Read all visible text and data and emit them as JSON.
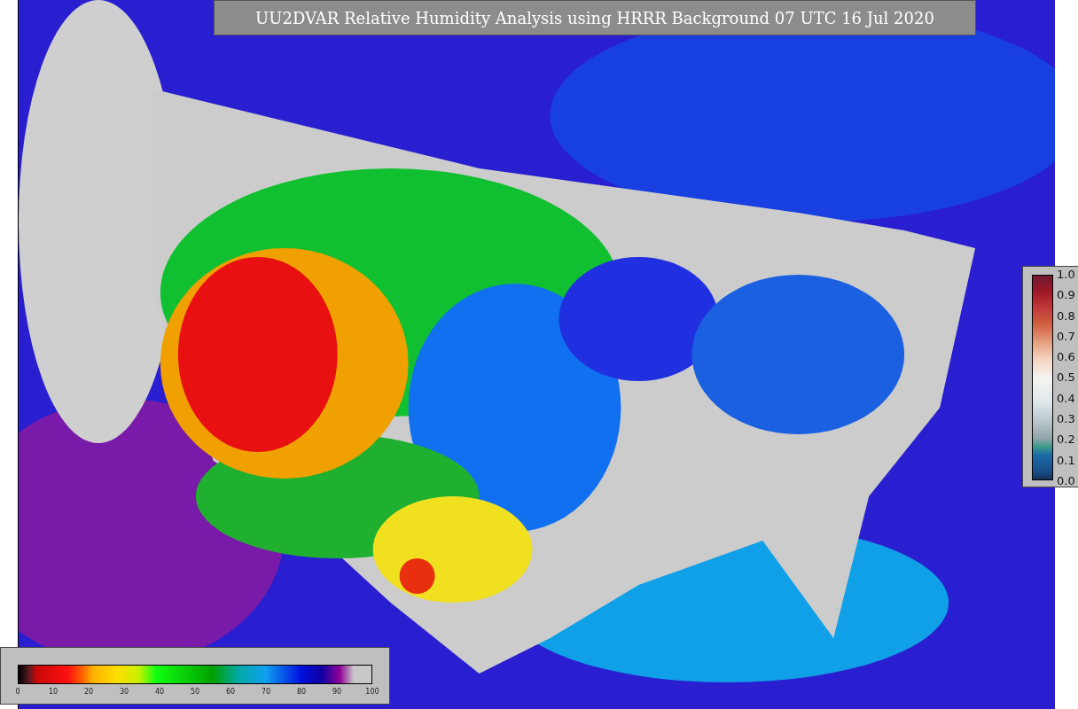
{
  "title": "UU2DVAR Relative Humidity Analysis using HRRR Background 07 UTC 16 Jul 2020",
  "humidity_colorbar": {
    "ticks": [
      "0",
      "10",
      "20",
      "30",
      "40",
      "50",
      "60",
      "70",
      "80",
      "90",
      "100"
    ]
  },
  "observation_colorbar": {
    "ticks": [
      "1.0",
      "0.9",
      "0.8",
      "0.7",
      "0.6",
      "0.5",
      "0.4",
      "0.3",
      "0.2",
      "0.1",
      "0.0"
    ]
  }
}
